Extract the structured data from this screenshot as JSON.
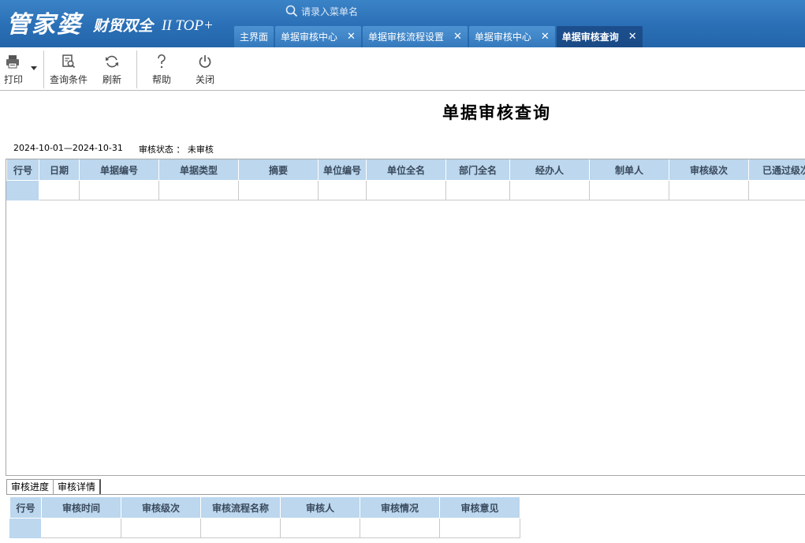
{
  "header": {
    "logo_main": "管家婆",
    "logo_sub": "财贸双全",
    "logo_ver": "II TOP+",
    "search_placeholder": "请录入菜单名",
    "tabs": [
      {
        "label": "主界面",
        "closable": false,
        "active": false
      },
      {
        "label": "单据审核中心",
        "closable": true,
        "active": false
      },
      {
        "label": "单据审核流程设置",
        "closable": true,
        "active": false
      },
      {
        "label": "单据审核中心",
        "closable": true,
        "active": false
      },
      {
        "label": "单据审核查询",
        "closable": true,
        "active": true
      }
    ],
    "close_glyph": "✕"
  },
  "toolbar": {
    "print": "打印",
    "query": "查询条件",
    "refresh": "刷新",
    "help": "帮助",
    "close": "关闭"
  },
  "page": {
    "title": "单据审核查询",
    "date_range": "2024-10-01—2024-10-31",
    "status_text": "审核状态 ： 未审核"
  },
  "main_table": {
    "columns": [
      "行号",
      "日期",
      "单据编号",
      "单据类型",
      "摘要",
      "单位编号",
      "单位全名",
      "部门全名",
      "经办人",
      "制单人",
      "审核级次",
      "已通过级次"
    ]
  },
  "sub_tabs": [
    "审核进度",
    "审核详情"
  ],
  "detail_table": {
    "columns": [
      "行号",
      "审核时间",
      "审核级次",
      "审核流程名称",
      "审核人",
      "审核情况",
      "审核意见"
    ]
  },
  "colors": {
    "header_bg": "#2a6fb5",
    "active_tab": "#1c4f8e",
    "grid_header": "#bcd7ee"
  }
}
